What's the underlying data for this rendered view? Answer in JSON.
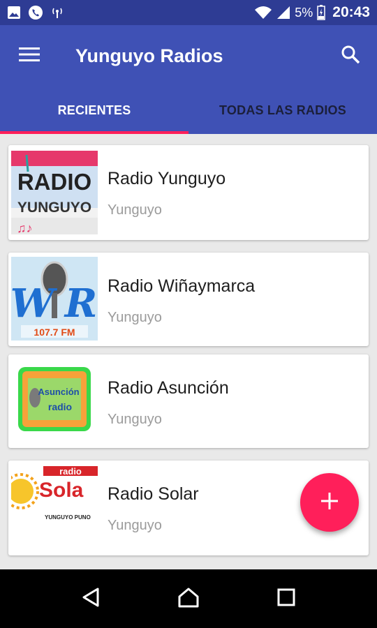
{
  "status_bar": {
    "battery": "5%",
    "time": "20:43",
    "icons": [
      "image-icon",
      "phone-icon",
      "broadcast-icon",
      "wifi-icon",
      "signal-icon",
      "battery-icon"
    ]
  },
  "app_bar": {
    "title": "Yunguyo Radios",
    "menu_icon": "hamburger-menu-icon",
    "search_icon": "search-icon",
    "color": "#3f51b5"
  },
  "tabs": [
    {
      "label": "RECIENTES",
      "active": true
    },
    {
      "label": "TODAS LAS RADIOS",
      "active": false
    }
  ],
  "stations": [
    {
      "name": "Radio Yunguyo",
      "location": "Yunguyo",
      "logo_text": [
        "RADIO",
        "YUNGUYO"
      ]
    },
    {
      "name": "Radio Wiñaymarca",
      "location": "Yunguyo",
      "logo_text": [
        "W",
        "R",
        "107.7 FM"
      ]
    },
    {
      "name": "Radio Asunción",
      "location": "Yunguyo",
      "logo_text": [
        "Asunción",
        "radio"
      ]
    },
    {
      "name": "Radio Solar",
      "location": "Yunguyo",
      "logo_text": [
        "radio",
        "Sola",
        "YUNGUYO PUNO"
      ]
    }
  ],
  "fab": {
    "icon": "plus-icon",
    "color": "#ff1f5a"
  },
  "nav_bar": {
    "icons": [
      "back-icon",
      "home-icon",
      "recents-icon"
    ]
  }
}
